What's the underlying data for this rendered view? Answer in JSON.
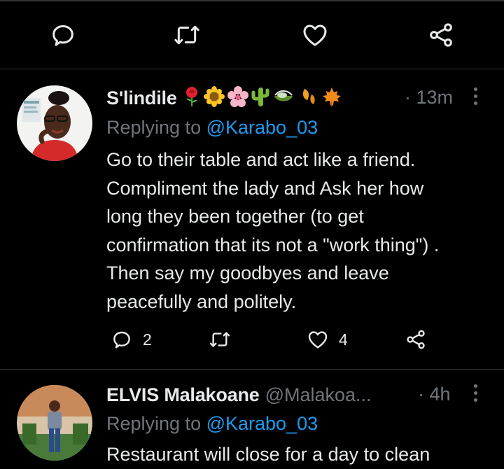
{
  "top_actions": {
    "reply_icon": "reply-icon",
    "retweet_icon": "retweet-icon",
    "like_icon": "like-icon",
    "share_icon": "share-icon"
  },
  "tweets": [
    {
      "display_name": "S'lindile",
      "handle": "",
      "emojis": [
        "rose",
        "sunflower",
        "cherry-blossom",
        "cactus",
        "nest",
        "autumn-leaves",
        "maple-leaf"
      ],
      "time": "· 13m",
      "reply_prefix": "Replying to ",
      "reply_mention": "@Karabo_03",
      "text": "Go to their table and act like a friend.\nCompliment the lady and Ask her how\nlong they been together (to get\nconfirmation that its not a \"work thing\") .\nThen say my goodbyes and leave\npeacefully and politely.",
      "reply_count": "2",
      "retweet_count": "",
      "like_count": "4"
    },
    {
      "display_name": "ELVIS Malakoane",
      "handle": "@Malakoa...",
      "time": "· 4h",
      "reply_prefix": "Replying to ",
      "reply_mention": "@Karabo_03",
      "text": "Restaurant will close for a day to clean"
    }
  ],
  "colors": {
    "background": "#000000",
    "text_primary": "#e7e9ea",
    "text_secondary": "#71767b",
    "accent": "#1d9bf0",
    "divider": "#2f3336"
  }
}
